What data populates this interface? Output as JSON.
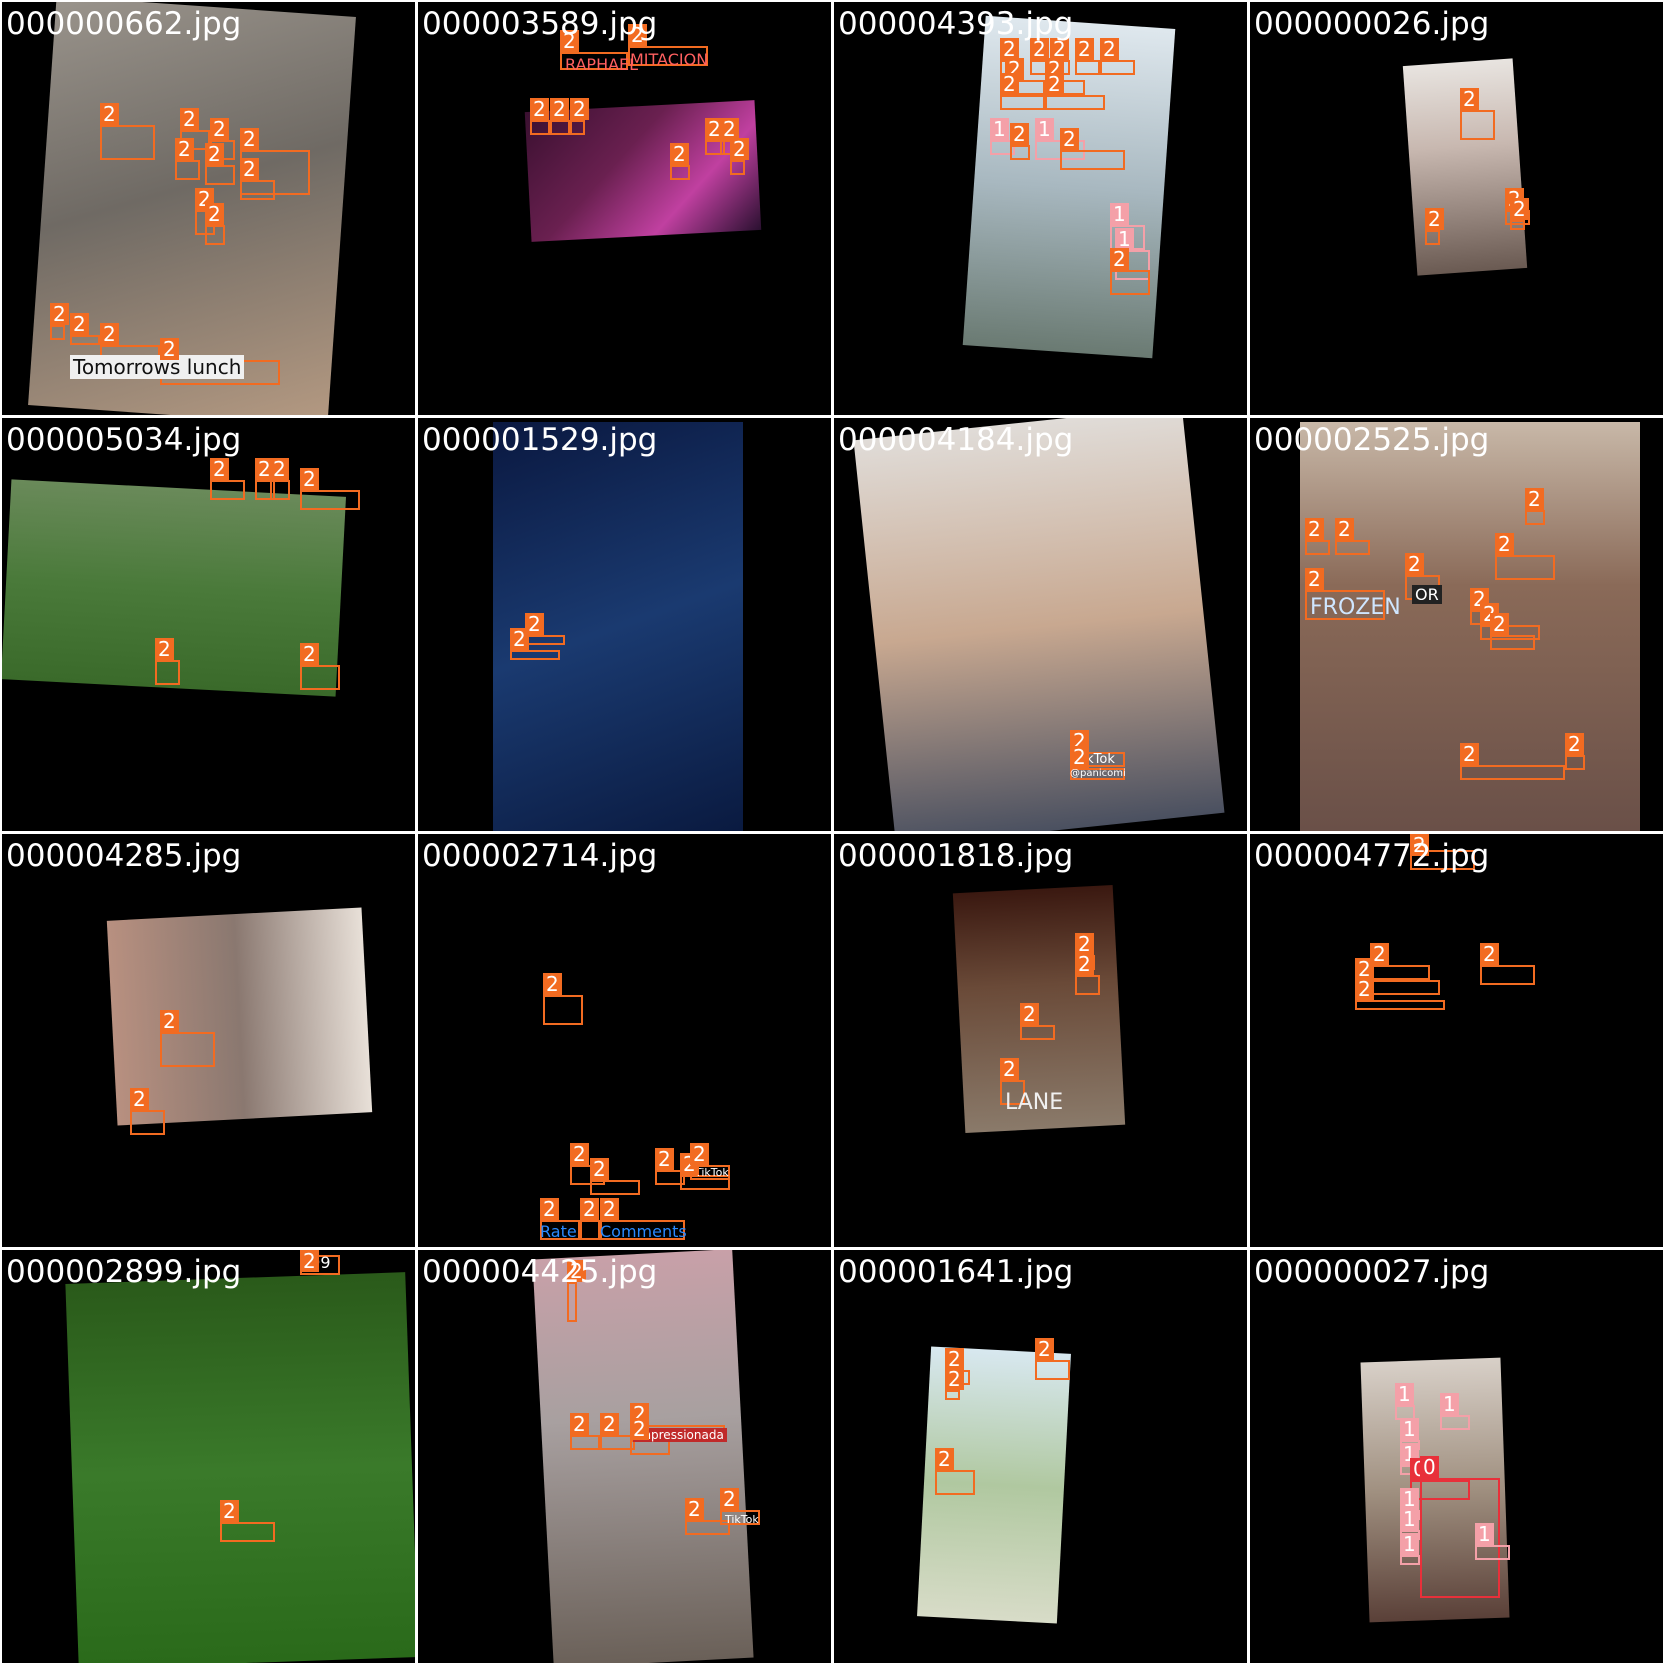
{
  "colors": {
    "background": "#000000",
    "class_2": "#f26b21",
    "class_1": "#f4a0a8",
    "class_0": "#e8303a"
  },
  "tiles": [
    {
      "filename": "000000662.jpg",
      "scene": {
        "bg": "linear-gradient(160deg,#9a948c,#6f6a64 45%,#b59a82)",
        "rotate": 4,
        "l": 40,
        "t": 4,
        "w": 300,
        "h": 410
      },
      "texts": [
        {
          "text": "Tomorrows lunch",
          "l": 70,
          "t": 355,
          "s": 20,
          "c": "#111",
          "bg": "#f0f0f0"
        }
      ],
      "boxes": [
        [
          100,
          125,
          55,
          35,
          "2"
        ],
        [
          180,
          130,
          30,
          20,
          "2"
        ],
        [
          210,
          140,
          25,
          20,
          "2"
        ],
        [
          240,
          150,
          70,
          45,
          "2"
        ],
        [
          175,
          160,
          25,
          20,
          "2"
        ],
        [
          205,
          165,
          30,
          20,
          "2"
        ],
        [
          240,
          180,
          35,
          20,
          "2"
        ],
        [
          195,
          210,
          20,
          25,
          "2"
        ],
        [
          205,
          225,
          20,
          20,
          "2"
        ],
        [
          50,
          325,
          15,
          15,
          "2"
        ],
        [
          70,
          335,
          30,
          10,
          "2"
        ],
        [
          100,
          345,
          60,
          25,
          "2"
        ],
        [
          160,
          360,
          120,
          25,
          "2"
        ]
      ]
    },
    {
      "filename": "000003589.jpg",
      "scene": {
        "bg": "linear-gradient(135deg,#3a1030,#6a2050 40%,#c040a0 70%,#2a1030)",
        "rotate": -3,
        "l": 110,
        "t": 104,
        "w": 230,
        "h": 130
      },
      "texts": [
        {
          "text": "MITACION",
          "l": 630,
          "t": 50,
          "s": 16,
          "c": "#ff6060",
          "bg": ""
        },
        {
          "text": "RAPHAEL",
          "l": 565,
          "t": 55,
          "s": 16,
          "c": "#ff6060",
          "bg": ""
        }
      ],
      "boxes": [
        [
          560,
          52,
          68,
          18,
          "2"
        ],
        [
          628,
          46,
          80,
          20,
          "2"
        ],
        [
          530,
          120,
          20,
          15,
          "2"
        ],
        [
          550,
          120,
          20,
          15,
          "2"
        ],
        [
          570,
          120,
          15,
          15,
          "2"
        ],
        [
          670,
          165,
          20,
          15,
          "2"
        ],
        [
          705,
          140,
          20,
          15,
          "2"
        ],
        [
          720,
          140,
          20,
          15,
          "2"
        ],
        [
          730,
          160,
          15,
          15,
          "2"
        ]
      ]
    },
    {
      "filename": "000004393.jpg",
      "scene": {
        "bg": "linear-gradient(180deg,#dfe8ee,#a8b8c0 50%,#6a7a72)",
        "rotate": 4,
        "l": 140,
        "t": 20,
        "w": 190,
        "h": 330
      },
      "texts": [],
      "boxes": [
        [
          1000,
          60,
          20,
          15,
          "2"
        ],
        [
          1030,
          60,
          25,
          15,
          "2"
        ],
        [
          1050,
          60,
          20,
          15,
          "2"
        ],
        [
          1075,
          60,
          25,
          15,
          "2"
        ],
        [
          1100,
          60,
          35,
          15,
          "2"
        ],
        [
          1005,
          80,
          40,
          15,
          "2"
        ],
        [
          1045,
          80,
          40,
          15,
          "2"
        ],
        [
          1000,
          95,
          45,
          15,
          "2"
        ],
        [
          1045,
          95,
          60,
          15,
          "2"
        ],
        [
          990,
          140,
          25,
          15,
          "1"
        ],
        [
          1010,
          145,
          20,
          15,
          "2"
        ],
        [
          1035,
          140,
          50,
          20,
          "1"
        ],
        [
          1060,
          150,
          65,
          20,
          "2"
        ],
        [
          1110,
          225,
          35,
          25,
          "1"
        ],
        [
          1115,
          250,
          35,
          30,
          "1"
        ],
        [
          1110,
          270,
          40,
          25,
          "2"
        ]
      ]
    },
    {
      "filename": "000000026.jpg",
      "scene": {
        "bg": "linear-gradient(180deg,#e8e4e0,#c8b8b0 40%,#6a5a52)",
        "rotate": -4,
        "l": 160,
        "t": 60,
        "w": 110,
        "h": 210
      },
      "texts": [],
      "boxes": [
        [
          1460,
          110,
          35,
          30,
          "2"
        ],
        [
          1505,
          210,
          25,
          15,
          "2"
        ],
        [
          1510,
          220,
          15,
          10,
          "2"
        ],
        [
          1425,
          230,
          15,
          15,
          "2"
        ]
      ]
    },
    {
      "filename": "000005034.jpg",
      "scene": {
        "bg": "linear-gradient(180deg,#6a8a5a,#4a7a3a 50%,#3a6a2a)",
        "rotate": 3,
        "l": 4,
        "t": 70,
        "w": 335,
        "h": 200
      },
      "texts": [],
      "boxes": [
        [
          210,
          480,
          35,
          20,
          "2"
        ],
        [
          255,
          480,
          20,
          20,
          "2"
        ],
        [
          270,
          480,
          20,
          20,
          "2"
        ],
        [
          300,
          490,
          60,
          20,
          "2"
        ],
        [
          155,
          660,
          25,
          25,
          "2"
        ],
        [
          300,
          665,
          40,
          25,
          "2"
        ]
      ]
    },
    {
      "filename": "000001529.jpg",
      "scene": {
        "bg": "linear-gradient(160deg,#0a1840,#1a3a70 50%,#0a1a40)",
        "rotate": 0,
        "l": 75,
        "t": 4,
        "w": 250,
        "h": 409
      },
      "texts": [],
      "boxes": [
        [
          525,
          635,
          40,
          10,
          "2"
        ],
        [
          510,
          650,
          50,
          10,
          "2"
        ]
      ]
    },
    {
      "filename": "000004184.jpg",
      "scene": {
        "bg": "linear-gradient(180deg,#e0dcd8,#c8a890 50%,#4a5060)",
        "rotate": -6,
        "l": 40,
        "t": 4,
        "w": 330,
        "h": 409
      },
      "texts": [
        {
          "text": "TikTok",
          "l": 1075,
          "t": 752,
          "s": 13,
          "c": "#fff",
          "bg": ""
        },
        {
          "text": "@panicomi",
          "l": 1070,
          "t": 768,
          "s": 10,
          "c": "#fff",
          "bg": ""
        }
      ],
      "boxes": [
        [
          1070,
          752,
          55,
          15,
          "2"
        ],
        [
          1070,
          768,
          55,
          12,
          "2"
        ]
      ]
    },
    {
      "filename": "000002525.jpg",
      "scene": {
        "bg": "linear-gradient(180deg,#c8b8a8,#8a6a58 40%,#6a5048)",
        "rotate": 0,
        "l": 50,
        "t": 4,
        "w": 340,
        "h": 409
      },
      "texts": [
        {
          "text": "FROZEN",
          "l": 1310,
          "t": 595,
          "s": 22,
          "c": "#cfe6ff",
          "bg": ""
        },
        {
          "text": "OR",
          "l": 1412,
          "t": 585,
          "s": 16,
          "c": "#fff",
          "bg": "#222"
        }
      ],
      "boxes": [
        [
          1305,
          540,
          25,
          15,
          "2"
        ],
        [
          1335,
          540,
          35,
          15,
          "2"
        ],
        [
          1305,
          590,
          80,
          30,
          "2"
        ],
        [
          1405,
          575,
          35,
          25,
          "2"
        ],
        [
          1495,
          555,
          60,
          25,
          "2"
        ],
        [
          1525,
          510,
          20,
          15,
          "2"
        ],
        [
          1470,
          610,
          20,
          15,
          "2"
        ],
        [
          1480,
          625,
          60,
          15,
          "2"
        ],
        [
          1490,
          635,
          45,
          15,
          "2"
        ],
        [
          1460,
          765,
          105,
          15,
          "2"
        ],
        [
          1565,
          755,
          20,
          15,
          "2"
        ]
      ]
    },
    {
      "filename": "000004285.jpg",
      "scene": {
        "bg": "linear-gradient(90deg,#b89080,#8a7870 50%,#e8e0d8)",
        "rotate": -3,
        "l": 110,
        "t": 80,
        "w": 255,
        "h": 205
      },
      "texts": [],
      "boxes": [
        [
          160,
          1032,
          55,
          35,
          "2"
        ],
        [
          130,
          1110,
          35,
          25,
          "2"
        ]
      ]
    },
    {
      "filename": "000002714.jpg",
      "scene": {
        "bg": "#000000",
        "rotate": 0,
        "l": 0,
        "t": 0,
        "w": 0,
        "h": 0
      },
      "texts": [
        {
          "text": "Rate",
          "l": 540,
          "t": 1222,
          "s": 16,
          "c": "#2a8aff",
          "bg": ""
        },
        {
          "text": "Comments",
          "l": 600,
          "t": 1222,
          "s": 16,
          "c": "#2a8aff",
          "bg": ""
        },
        {
          "text": "TikTok",
          "l": 695,
          "t": 1166,
          "s": 11,
          "c": "#fff",
          "bg": ""
        }
      ],
      "boxes": [
        [
          543,
          995,
          40,
          30,
          "2"
        ],
        [
          570,
          1165,
          35,
          20,
          "2"
        ],
        [
          590,
          1180,
          50,
          15,
          "2"
        ],
        [
          655,
          1170,
          30,
          15,
          "2"
        ],
        [
          680,
          1175,
          50,
          15,
          "2"
        ],
        [
          690,
          1165,
          40,
          15,
          "2"
        ],
        [
          540,
          1220,
          40,
          20,
          "2"
        ],
        [
          580,
          1220,
          20,
          20,
          "2"
        ],
        [
          600,
          1220,
          85,
          20,
          "2"
        ]
      ]
    },
    {
      "filename": "000001818.jpg",
      "scene": {
        "bg": "linear-gradient(180deg,#3a1810,#6a4a38 40%,#8a7a6a)",
        "rotate": -3,
        "l": 125,
        "t": 55,
        "w": 160,
        "h": 240
      },
      "texts": [
        {
          "text": "LANE",
          "l": 1005,
          "t": 1090,
          "s": 22,
          "c": "#f0f0f0",
          "bg": ""
        }
      ],
      "boxes": [
        [
          1075,
          955,
          20,
          15,
          "2"
        ],
        [
          1075,
          975,
          25,
          20,
          "2"
        ],
        [
          1020,
          1025,
          35,
          15,
          "2"
        ],
        [
          1000,
          1080,
          25,
          25,
          "2"
        ]
      ]
    },
    {
      "filename": "000004772.jpg",
      "scene": {
        "bg": "#000000",
        "rotate": 0,
        "l": 0,
        "t": 0,
        "w": 0,
        "h": 0
      },
      "texts": [],
      "boxes": [
        [
          1410,
          850,
          65,
          20,
          "2"
        ],
        [
          1370,
          965,
          60,
          15,
          "2"
        ],
        [
          1355,
          980,
          85,
          15,
          "2"
        ],
        [
          1480,
          965,
          55,
          20,
          "2"
        ],
        [
          1355,
          1000,
          90,
          10,
          "2"
        ]
      ]
    },
    {
      "filename": "000002899.jpg",
      "scene": {
        "bg": "linear-gradient(180deg,#2a5a1a,#3a7a2a 50%,#2a6a1a)",
        "rotate": -2,
        "l": 70,
        "t": 28,
        "w": 340,
        "h": 385
      },
      "texts": [
        {
          "text": "999",
          "l": 300,
          "t": 1253,
          "s": 16,
          "c": "#fff",
          "bg": ""
        }
      ],
      "boxes": [
        [
          300,
          1255,
          40,
          20,
          "2"
        ],
        [
          220,
          1522,
          55,
          20,
          "2"
        ]
      ]
    },
    {
      "filename": "000004425.jpg",
      "scene": {
        "bg": "linear-gradient(180deg,#c8a0a8,#a8a0a0 40%,#6a6058)",
        "rotate": -3,
        "l": 125,
        "t": 4,
        "w": 200,
        "h": 409
      },
      "texts": [
        {
          "text": "impressionada",
          "l": 633,
          "t": 1428,
          "s": 12,
          "c": "#fff",
          "bg": "#c02a2a"
        },
        {
          "text": "TikTok",
          "l": 725,
          "t": 1513,
          "s": 11,
          "c": "#fff",
          "bg": ""
        }
      ],
      "boxes": [
        [
          567,
          1282,
          10,
          40,
          "2"
        ],
        [
          570,
          1435,
          30,
          15,
          "2"
        ],
        [
          600,
          1435,
          35,
          15,
          "2"
        ],
        [
          630,
          1425,
          95,
          15,
          "2"
        ],
        [
          630,
          1440,
          40,
          15,
          "2"
        ],
        [
          685,
          1520,
          45,
          15,
          "2"
        ],
        [
          720,
          1510,
          40,
          15,
          "2"
        ]
      ]
    },
    {
      "filename": "000001641.jpg",
      "scene": {
        "bg": "linear-gradient(180deg,#d8e8f0,#b0c8a0 50%,#d8dcc8)",
        "rotate": 3,
        "l": 90,
        "t": 100,
        "w": 140,
        "h": 270
      },
      "texts": [],
      "boxes": [
        [
          945,
          1370,
          25,
          15,
          "2"
        ],
        [
          945,
          1390,
          15,
          10,
          "2"
        ],
        [
          1035,
          1360,
          35,
          20,
          "2"
        ],
        [
          935,
          1470,
          40,
          25,
          "2"
        ]
      ]
    },
    {
      "filename": "000000027.jpg",
      "scene": {
        "bg": "linear-gradient(180deg,#d8d0c8,#a09080 50%,#5a4038)",
        "rotate": -2,
        "l": 115,
        "t": 110,
        "w": 140,
        "h": 260
      },
      "texts": [],
      "boxes": [
        [
          1395,
          1405,
          20,
          15,
          "1"
        ],
        [
          1440,
          1415,
          30,
          15,
          "1"
        ],
        [
          1400,
          1440,
          20,
          10,
          "1"
        ],
        [
          1400,
          1465,
          20,
          10,
          "1"
        ],
        [
          1410,
          1480,
          60,
          20,
          "0"
        ],
        [
          1400,
          1510,
          20,
          10,
          "1"
        ],
        [
          1400,
          1530,
          20,
          10,
          "1"
        ],
        [
          1400,
          1555,
          20,
          10,
          "1"
        ],
        [
          1420,
          1478,
          80,
          120,
          "0"
        ],
        [
          1475,
          1545,
          35,
          15,
          "1"
        ]
      ]
    }
  ]
}
